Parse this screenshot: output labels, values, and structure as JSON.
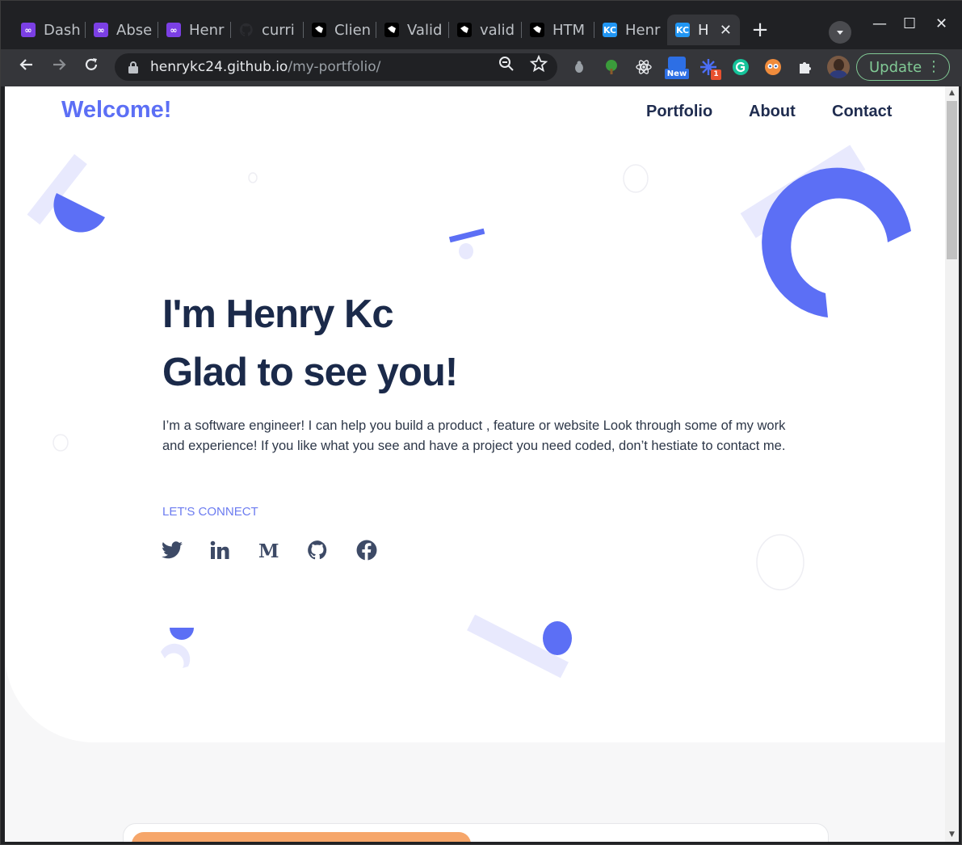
{
  "browser": {
    "tabs": [
      {
        "label": "Dash",
        "favicon": "stack-icon"
      },
      {
        "label": "Abse",
        "favicon": "stack-icon"
      },
      {
        "label": "Henr",
        "favicon": "stack-icon"
      },
      {
        "label": "curri",
        "favicon": "github-icon"
      },
      {
        "label": "Clien",
        "favicon": "bear-icon"
      },
      {
        "label": "Valid",
        "favicon": "bear-icon"
      },
      {
        "label": "valid",
        "favicon": "bear-icon"
      },
      {
        "label": "HTM",
        "favicon": "bear-icon"
      },
      {
        "label": "Henr",
        "favicon": "kc-icon"
      },
      {
        "label": "H",
        "favicon": "kc-icon",
        "active": true
      }
    ],
    "kc_badge": "KC",
    "address": {
      "host": "henrykc24.github.io",
      "path": "/my-portfolio/"
    },
    "ext_new_badge": "New",
    "ext_count_badge": "1",
    "update_label": "Update"
  },
  "page": {
    "brand": "Welcome!",
    "nav": [
      "Portfolio",
      "About",
      "Contact"
    ],
    "headline_line1": "I'm Henry Kc",
    "headline_line2": "Glad to see you!",
    "intro": "I’m a software engineer! I can help you build a product , feature or website Look through some of my work and experience! If you like what you see and have a project you need coded, don’t hestiate to contact me.",
    "connect_label": "LET'S CONNECT",
    "social_icons": [
      "twitter-icon",
      "linkedin-icon",
      "medium-icon",
      "github-icon",
      "facebook-icon"
    ]
  },
  "colors": {
    "accent": "#5c6ff5",
    "accent_light": "#e8e9fd",
    "heading": "#1b2a4a",
    "card_bar": "#f6a66a",
    "update_green": "#81c995"
  }
}
